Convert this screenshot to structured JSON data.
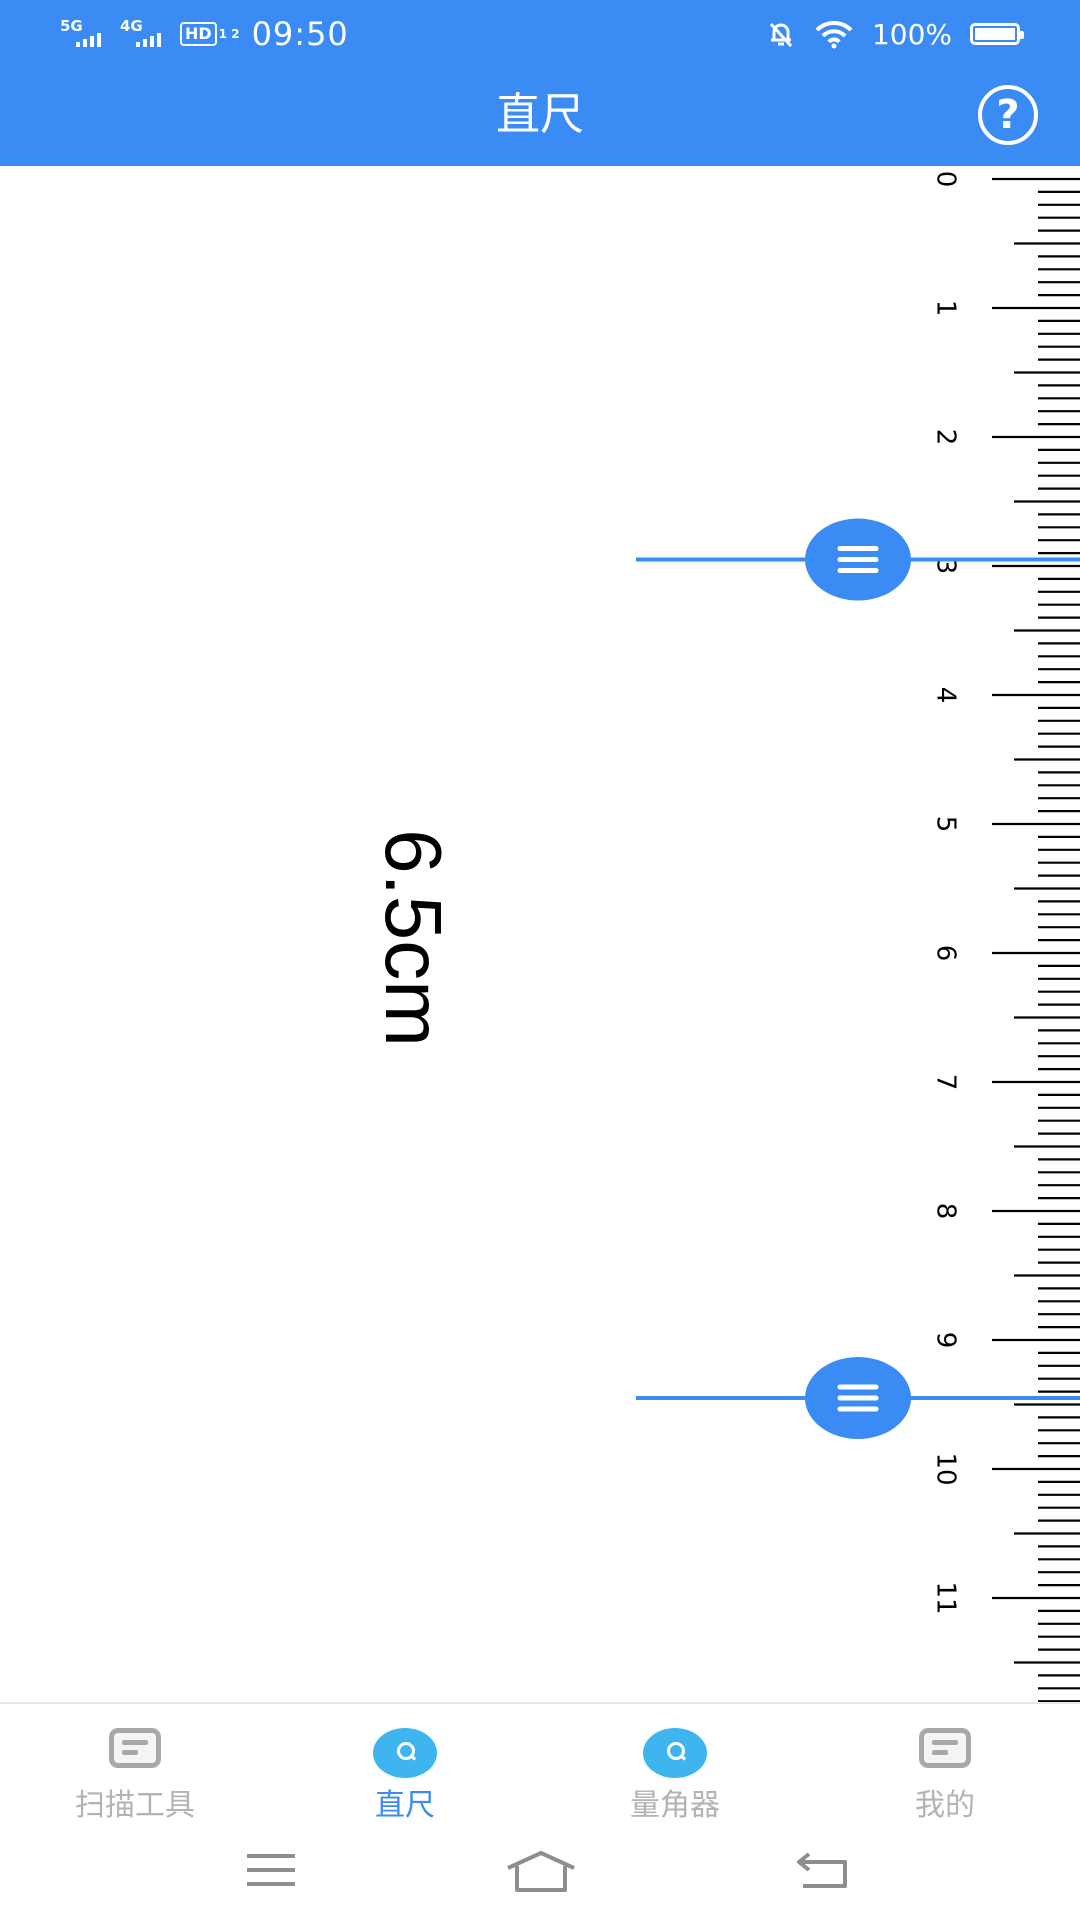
{
  "status_bar": {
    "network_1": "5G",
    "network_2": "4G",
    "hd_label": "HD",
    "hd_sub": "1 2",
    "time": "09:50",
    "battery": "100%"
  },
  "header": {
    "title": "直尺",
    "help_label": "?"
  },
  "ruler": {
    "unit": "cm",
    "tick_labels": [
      "0",
      "1",
      "2",
      "3",
      "4",
      "5",
      "6",
      "7",
      "8",
      "9",
      "10",
      "11"
    ],
    "min": 0,
    "max": 11.9,
    "handle_top_cm": 2.95,
    "handle_bottom_cm": 9.45,
    "accent": "#3a8cf4",
    "handle_icon": "drag-lines-icon"
  },
  "measurement": {
    "text": "6.5cm"
  },
  "bottom_nav": {
    "tabs": [
      {
        "label": "扫描工具",
        "icon": "document-icon",
        "active": false
      },
      {
        "label": "直尺",
        "icon": "search-icon",
        "active": true
      },
      {
        "label": "量角器",
        "icon": "search-icon",
        "active": false
      },
      {
        "label": "我的",
        "icon": "document-icon",
        "active": false
      }
    ]
  },
  "system_nav": {
    "icons": [
      "menu-icon",
      "home-icon",
      "back-icon"
    ]
  },
  "colors": {
    "primary": "#3a8cf4",
    "tab_icon_active": "#3fb5f0",
    "inactive": "#b3b3b3"
  }
}
